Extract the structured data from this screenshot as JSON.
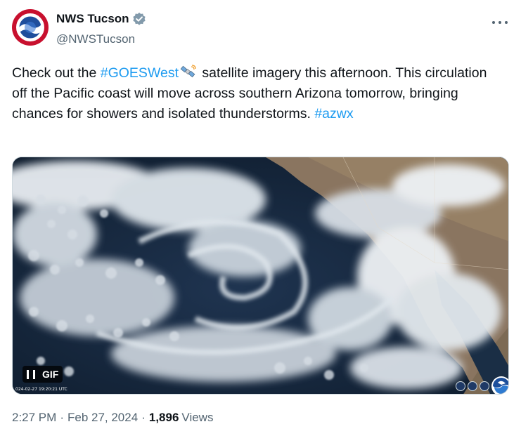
{
  "author": {
    "name": "NWS Tucson",
    "handle": "@NWSTucson",
    "avatar_icon": "nws-logo-icon",
    "verified_icon": "verified-badge-icon",
    "avatar_ring_text": "NATIONAL WEATHER SERVICE"
  },
  "tweet": {
    "text_part1": "Check out the ",
    "hashtag1": "#GOESWest",
    "text_part2": " satellite imagery this afternoon. This circulation off the Pacific coast will move across southern Arizona tomorrow, bringing chances for showers and isolated thunderstorms. ",
    "hashtag2": "#azwx",
    "emoji_icon": "satellite-icon"
  },
  "media": {
    "gif_label": "GIF",
    "pause_icon": "pause-icon",
    "timestamp_overlay": "024-02-27 19:20:21 UTC",
    "logo_icon": "noaa-logo-icon"
  },
  "meta": {
    "time": "2:27 PM",
    "separator": "·",
    "date": "Feb 27, 2024",
    "views_count": "1,896",
    "views_label": "Views"
  },
  "more_icon": "more-options-icon",
  "colors": {
    "link": "#1d9bf0",
    "text": "#0f1419",
    "secondary": "#536471",
    "verified": "#829aab"
  }
}
